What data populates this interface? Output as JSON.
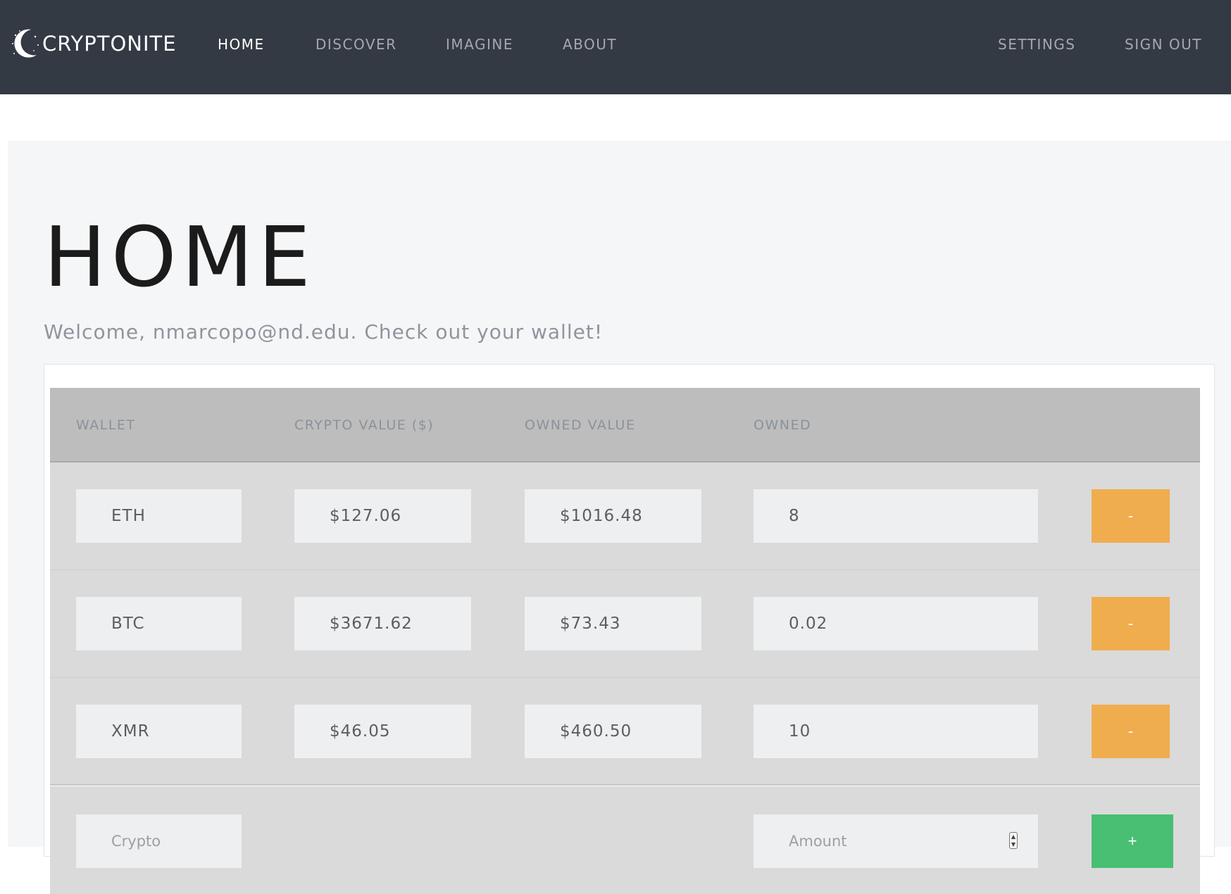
{
  "app": {
    "name": "CRYPTONITE",
    "logo": "crescent-moon-stars-icon"
  },
  "nav": {
    "left": [
      {
        "label": "HOME",
        "active": true
      },
      {
        "label": "DISCOVER",
        "active": false
      },
      {
        "label": "IMAGINE",
        "active": false
      },
      {
        "label": "ABOUT",
        "active": false
      }
    ],
    "right": [
      {
        "label": "SETTINGS"
      },
      {
        "label": "SIGN OUT"
      }
    ]
  },
  "page": {
    "title": "HOME",
    "welcome": "Welcome, nmarcopo@nd.edu. Check out your wallet!"
  },
  "table": {
    "headers": [
      "WALLET",
      "CRYPTO VALUE ($)",
      "OWNED VALUE",
      "OWNED"
    ],
    "rows": [
      {
        "wallet": "ETH",
        "crypto_value": "$127.06",
        "owned_value": "$1016.48",
        "owned": "8",
        "action": "-"
      },
      {
        "wallet": "BTC",
        "crypto_value": "$3671.62",
        "owned_value": "$73.43",
        "owned": "0.02",
        "action": "-"
      },
      {
        "wallet": "XMR",
        "crypto_value": "$46.05",
        "owned_value": "$460.50",
        "owned": "10",
        "action": "-"
      }
    ],
    "add_row": {
      "crypto_placeholder": "Crypto",
      "amount_placeholder": "Amount",
      "add_label": "+"
    }
  },
  "colors": {
    "navbar": "#343a44",
    "remove_button": "#efad4e",
    "add_button": "#48bf73",
    "table_header": "#bdbdbd",
    "row": "#dadada"
  }
}
